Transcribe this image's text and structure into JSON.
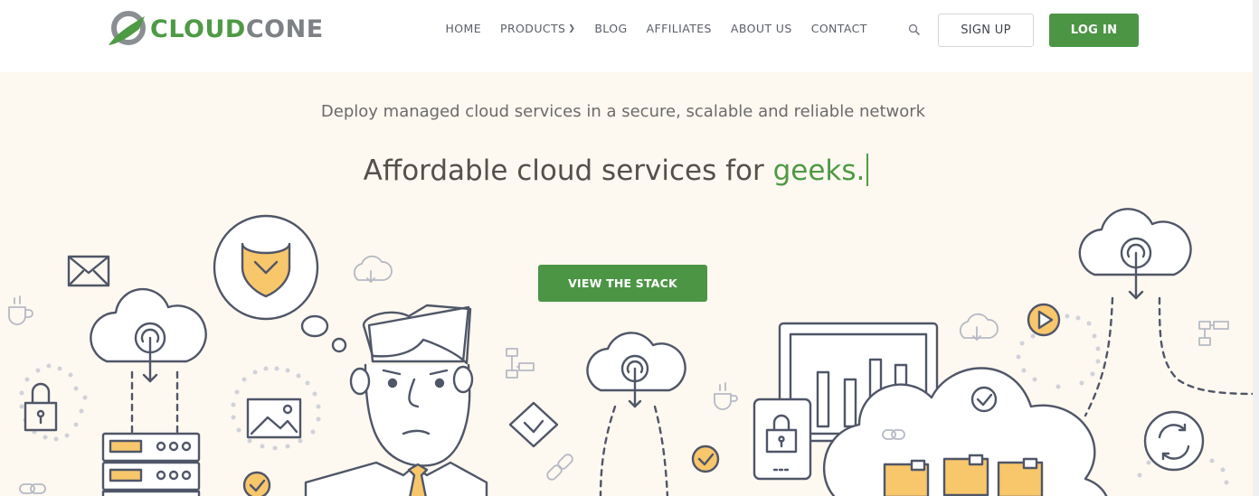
{
  "brand": {
    "part1": "CLOUD",
    "part2": "CONE",
    "green": "#4e9a45",
    "gray": "#7d8084"
  },
  "nav": {
    "items": [
      {
        "label": "HOME"
      },
      {
        "label": "PRODUCTS",
        "has_dropdown": true
      },
      {
        "label": "BLOG"
      },
      {
        "label": "AFFILIATES"
      },
      {
        "label": "ABOUT US"
      },
      {
        "label": "CONTACT"
      }
    ],
    "search_icon": "search-icon"
  },
  "auth": {
    "signup": "SIGN UP",
    "login": "LOG IN"
  },
  "hero": {
    "subtitle": "Deploy managed cloud services in a secure, scalable and reliable network",
    "headline_prefix": "Affordable cloud services for ",
    "headline_accent": "geeks.",
    "cta": "VIEW THE STACK"
  },
  "colors": {
    "accent_green": "#4c9545",
    "background": "#fdf8f0",
    "illustration_orange": "#f8c66b",
    "illustration_stroke": "#4f5668"
  }
}
